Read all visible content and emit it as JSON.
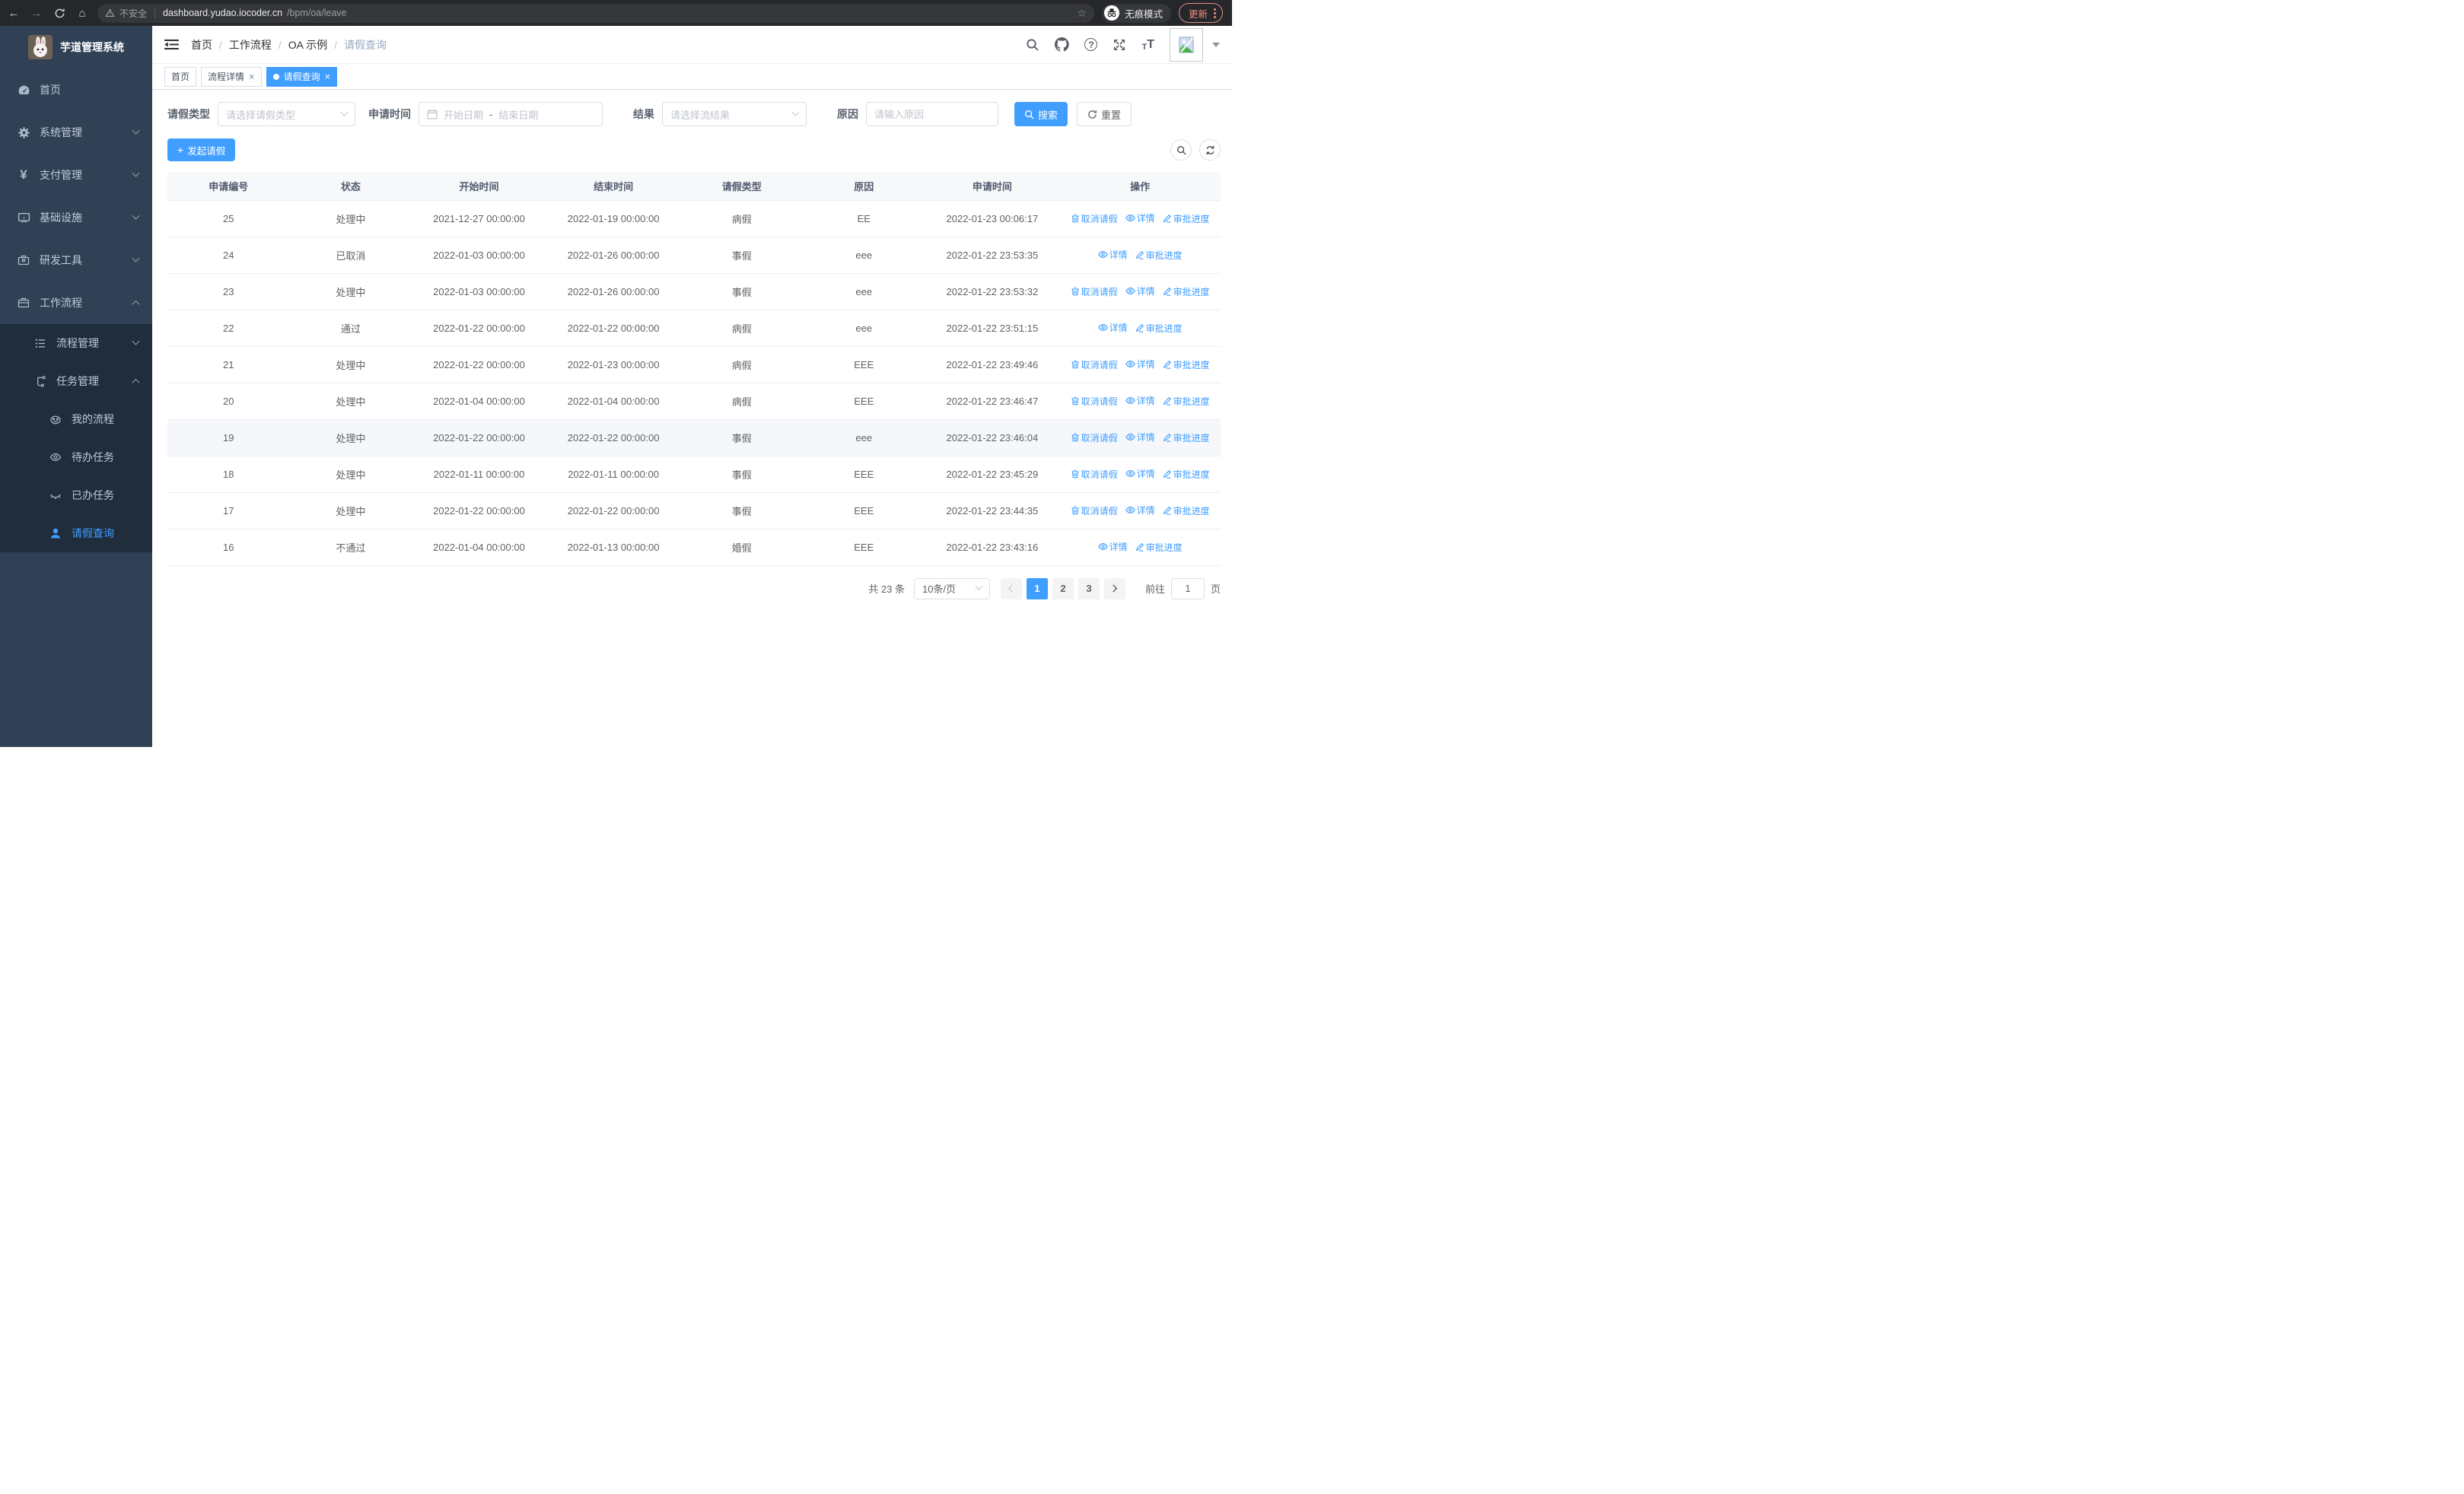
{
  "browser": {
    "security_label": "不安全",
    "url_host": "dashboard.yudao.iocoder.cn",
    "url_path": "/bpm/oa/leave",
    "incognito_label": "无痕模式",
    "update_label": "更新"
  },
  "sidebar": {
    "title": "芋道管理系统",
    "items": [
      {
        "label": "首页"
      },
      {
        "label": "系统管理"
      },
      {
        "label": "支付管理"
      },
      {
        "label": "基础设施"
      },
      {
        "label": "研发工具"
      },
      {
        "label": "工作流程"
      },
      {
        "label": "流程管理"
      },
      {
        "label": "任务管理"
      },
      {
        "label": "我的流程"
      },
      {
        "label": "待办任务"
      },
      {
        "label": "已办任务"
      },
      {
        "label": "请假查询"
      }
    ]
  },
  "breadcrumb": {
    "items": [
      "首页",
      "工作流程",
      "OA 示例",
      "请假查询"
    ]
  },
  "tabs": [
    {
      "label": "首页"
    },
    {
      "label": "流程详情"
    },
    {
      "label": "请假查询"
    }
  ],
  "filters": {
    "leave_type_label": "请假类型",
    "leave_type_placeholder": "请选择请假类型",
    "apply_time_label": "申请时间",
    "date_start_placeholder": "开始日期",
    "date_separator": "-",
    "date_end_placeholder": "结束日期",
    "result_label": "结果",
    "result_placeholder": "请选择流结果",
    "reason_label": "原因",
    "reason_placeholder": "请输入原因",
    "search_label": "搜索",
    "reset_label": "重置"
  },
  "toolbar": {
    "create_label": "发起请假"
  },
  "table": {
    "columns": [
      "申请编号",
      "状态",
      "开始时间",
      "结束时间",
      "请假类型",
      "原因",
      "申请时间",
      "操作"
    ],
    "action_labels": {
      "cancel": "取消请假",
      "detail": "详情",
      "progress": "审批进度"
    },
    "rows": [
      {
        "id": "25",
        "status": "处理中",
        "start": "2021-12-27 00:00:00",
        "end": "2022-01-19 00:00:00",
        "type": "病假",
        "reason": "EE",
        "apply_time": "2022-01-23 00:06:17",
        "actions": [
          "cancel",
          "detail",
          "progress"
        ]
      },
      {
        "id": "24",
        "status": "已取消",
        "start": "2022-01-03 00:00:00",
        "end": "2022-01-26 00:00:00",
        "type": "事假",
        "reason": "eee",
        "apply_time": "2022-01-22 23:53:35",
        "actions": [
          "detail",
          "progress"
        ]
      },
      {
        "id": "23",
        "status": "处理中",
        "start": "2022-01-03 00:00:00",
        "end": "2022-01-26 00:00:00",
        "type": "事假",
        "reason": "eee",
        "apply_time": "2022-01-22 23:53:32",
        "actions": [
          "cancel",
          "detail",
          "progress"
        ]
      },
      {
        "id": "22",
        "status": "通过",
        "start": "2022-01-22 00:00:00",
        "end": "2022-01-22 00:00:00",
        "type": "病假",
        "reason": "eee",
        "apply_time": "2022-01-22 23:51:15",
        "actions": [
          "detail",
          "progress"
        ]
      },
      {
        "id": "21",
        "status": "处理中",
        "start": "2022-01-22 00:00:00",
        "end": "2022-01-23 00:00:00",
        "type": "病假",
        "reason": "EEE",
        "apply_time": "2022-01-22 23:49:46",
        "actions": [
          "cancel",
          "detail",
          "progress"
        ]
      },
      {
        "id": "20",
        "status": "处理中",
        "start": "2022-01-04 00:00:00",
        "end": "2022-01-04 00:00:00",
        "type": "病假",
        "reason": "EEE",
        "apply_time": "2022-01-22 23:46:47",
        "actions": [
          "cancel",
          "detail",
          "progress"
        ]
      },
      {
        "id": "19",
        "status": "处理中",
        "start": "2022-01-22 00:00:00",
        "end": "2022-01-22 00:00:00",
        "type": "事假",
        "reason": "eee",
        "apply_time": "2022-01-22 23:46:04",
        "actions": [
          "cancel",
          "detail",
          "progress"
        ],
        "highlighted": true
      },
      {
        "id": "18",
        "status": "处理中",
        "start": "2022-01-11 00:00:00",
        "end": "2022-01-11 00:00:00",
        "type": "事假",
        "reason": "EEE",
        "apply_time": "2022-01-22 23:45:29",
        "actions": [
          "cancel",
          "detail",
          "progress"
        ]
      },
      {
        "id": "17",
        "status": "处理中",
        "start": "2022-01-22 00:00:00",
        "end": "2022-01-22 00:00:00",
        "type": "事假",
        "reason": "EEE",
        "apply_time": "2022-01-22 23:44:35",
        "actions": [
          "cancel",
          "detail",
          "progress"
        ]
      },
      {
        "id": "16",
        "status": "不通过",
        "start": "2022-01-04 00:00:00",
        "end": "2022-01-13 00:00:00",
        "type": "婚假",
        "reason": "EEE",
        "apply_time": "2022-01-22 23:43:16",
        "actions": [
          "detail",
          "progress"
        ]
      }
    ]
  },
  "pagination": {
    "total_label": "共 23 条",
    "page_size_label": "10条/页",
    "pages": [
      "1",
      "2",
      "3"
    ],
    "active_page": "1",
    "jump_prefix": "前往",
    "jump_value": "1",
    "jump_suffix": "页"
  },
  "colors": {
    "accent": "#409eff",
    "sidebar_bg": "#304156",
    "submenu_bg": "#1f2d3d",
    "update_red": "#f08b80"
  }
}
